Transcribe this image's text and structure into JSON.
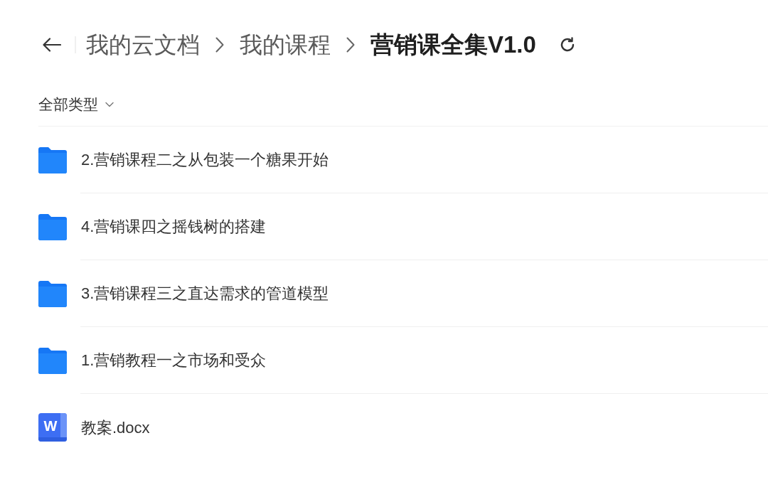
{
  "header": {
    "breadcrumbs": [
      {
        "label": "我的云文档",
        "current": false
      },
      {
        "label": "我的课程",
        "current": false
      },
      {
        "label": "营销课全集V1.0",
        "current": true
      }
    ]
  },
  "filter": {
    "label": "全部类型"
  },
  "files": [
    {
      "kind": "folder",
      "name": "2.营销课程二之从包装一个糖果开始"
    },
    {
      "kind": "folder",
      "name": "4.营销课四之摇钱树的搭建"
    },
    {
      "kind": "folder",
      "name": "3.营销课程三之直达需求的管道模型"
    },
    {
      "kind": "folder",
      "name": "1.营销教程一之市场和受众"
    },
    {
      "kind": "document",
      "name": "教案.docx",
      "icon_letter": "W"
    }
  ]
}
